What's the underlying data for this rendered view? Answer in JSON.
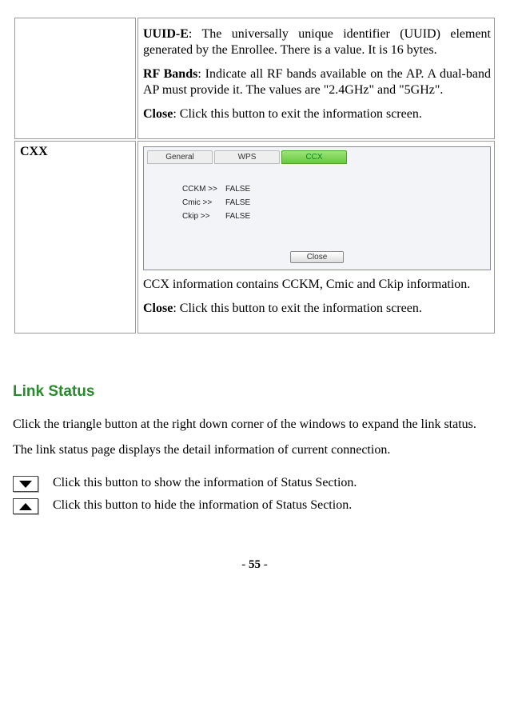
{
  "table": {
    "row1": {
      "uuid_label": "UUID-E",
      "uuid_text": ": The universally unique identifier (UUID) element generated by the Enrollee. There is a value. It is 16 bytes.",
      "rf_label": "RF Bands",
      "rf_text": ": Indicate all RF bands available on the AP. A dual-band AP must provide it. The values are \"2.4GHz\" and \"5GHz\".",
      "close_label": "Close",
      "close_text": ": Click this button to exit the information screen."
    },
    "row2": {
      "left_label": "CXX",
      "tabs": {
        "general": "General",
        "wps": "WPS",
        "ccx": "CCX"
      },
      "kv": {
        "cckm_key": "CCKM >>",
        "cckm_val": "FALSE",
        "cmic_key": "Cmic >>",
        "cmic_val": "FALSE",
        "ckip_key": "Ckip >>",
        "ckip_val": "FALSE"
      },
      "close_btn": "Close",
      "ccx_info": "CCX information contains CCKM, Cmic and Ckip information.",
      "close_label": "Close",
      "close_text": ": Click this button to exit the information screen."
    }
  },
  "link_status": {
    "heading": "Link Status",
    "heading_color": "#2a8a2e",
    "body": "Click the triangle button at the right down corner of the windows to expand the link status. The link status page displays the detail information of current connection.",
    "down_desc": "Click this button to show the information of Status Section.",
    "up_desc": "Click this button to hide the information of Status Section."
  },
  "page": {
    "dash_l": "- ",
    "num": "55",
    "dash_r": " -"
  }
}
